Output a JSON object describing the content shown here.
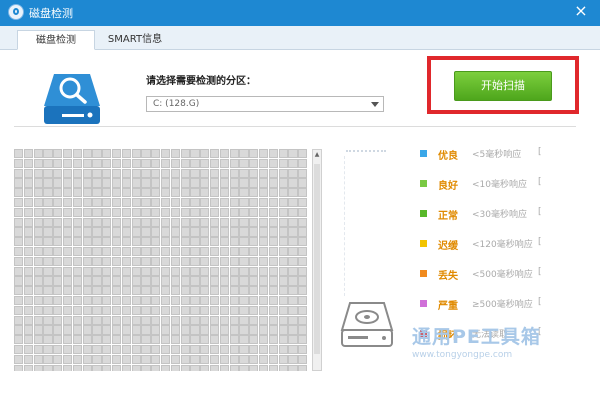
{
  "window": {
    "title": "磁盘检测",
    "close_glyph": "×"
  },
  "tabs": [
    {
      "label": "磁盘检测",
      "active": true
    },
    {
      "label": "SMART信息",
      "active": false
    }
  ],
  "partition": {
    "label": "请选择需要检测的分区：",
    "selected_value": "C: (128.G)"
  },
  "start_button": {
    "label": "开始扫描"
  },
  "legend": [
    {
      "name": "优良",
      "desc": "<5毫秒响应",
      "count": "[",
      "color": "#3aa7e8"
    },
    {
      "name": "良好",
      "desc": "<10毫秒响应",
      "count": "[",
      "color": "#7ac943"
    },
    {
      "name": "正常",
      "desc": "<30毫秒响应",
      "count": "[",
      "color": "#58b82a"
    },
    {
      "name": "迟缓",
      "desc": "<120毫秒响应",
      "count": "[",
      "color": "#f2c400"
    },
    {
      "name": "丢失",
      "desc": "<500毫秒响应",
      "count": "[",
      "color": "#f08a1e"
    },
    {
      "name": "严重",
      "desc": "≥500毫秒响应",
      "count": "[",
      "color": "#d070d8"
    },
    {
      "name": "损坏",
      "desc": "无法读取",
      "count": "[",
      "color": "#e02020"
    }
  ],
  "watermark": {
    "main": "通用PE工具箱",
    "url": "www.tongyongpe.com"
  },
  "colors": {
    "titlebar": "#1e88d2",
    "accent_green": "#5cb82a",
    "highlight_red": "#e0282c",
    "grid_cell": "#d9d9d9"
  }
}
